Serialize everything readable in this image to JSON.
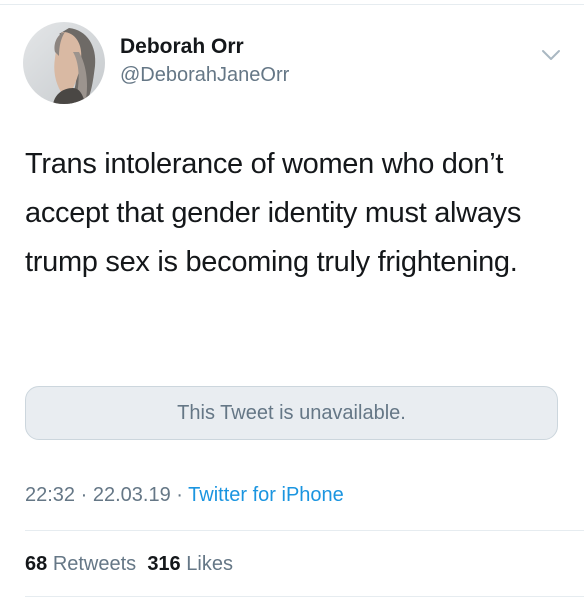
{
  "author": {
    "display_name": "Deborah Orr",
    "handle": "@DeborahJaneOrr"
  },
  "tweet": {
    "text": "Trans intolerance of women who don’t accept that gender identity must always trump sex is becoming truly frightening.",
    "quoted_tweet_notice": "This Tweet is unavailable."
  },
  "meta": {
    "time": "22:32",
    "separator": "·",
    "date": "22.03.19",
    "source": "Twitter for iPhone"
  },
  "stats": {
    "retweets_count": "68",
    "retweets_label": "Retweets",
    "likes_count": "316",
    "likes_label": "Likes"
  },
  "icons": {
    "menu": "chevron-down-icon"
  },
  "colors": {
    "text": "#14171a",
    "secondary": "#657786",
    "link": "#1b95e0",
    "divider": "#e6ecf0",
    "quote_bg": "#e9edf1"
  }
}
